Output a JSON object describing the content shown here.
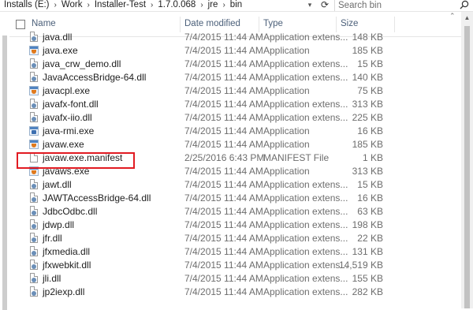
{
  "breadcrumb": [
    "Installs (E:)",
    "Work",
    "Installer-Test",
    "1.7.0.068",
    "jre",
    "bin"
  ],
  "breadcrumb_separator": "›",
  "search": {
    "placeholder": "Search bin"
  },
  "columns": {
    "name": "Name",
    "date": "Date modified",
    "type": "Type",
    "size": "Size"
  },
  "files": [
    {
      "name": "java.dll",
      "date": "7/4/2015 11:44 AM",
      "type": "Application extens...",
      "size": "148 KB",
      "icon": "dll-icon"
    },
    {
      "name": "java.exe",
      "date": "7/4/2015 11:44 AM",
      "type": "Application",
      "size": "185 KB",
      "icon": "java-exe-icon"
    },
    {
      "name": "java_crw_demo.dll",
      "date": "7/4/2015 11:44 AM",
      "type": "Application extens...",
      "size": "15 KB",
      "icon": "dll-icon"
    },
    {
      "name": "JavaAccessBridge-64.dll",
      "date": "7/4/2015 11:44 AM",
      "type": "Application extens...",
      "size": "140 KB",
      "icon": "dll-icon"
    },
    {
      "name": "javacpl.exe",
      "date": "7/4/2015 11:44 AM",
      "type": "Application",
      "size": "75 KB",
      "icon": "java-exe-icon"
    },
    {
      "name": "javafx-font.dll",
      "date": "7/4/2015 11:44 AM",
      "type": "Application extens...",
      "size": "313 KB",
      "icon": "dll-icon"
    },
    {
      "name": "javafx-iio.dll",
      "date": "7/4/2015 11:44 AM",
      "type": "Application extens...",
      "size": "225 KB",
      "icon": "dll-icon"
    },
    {
      "name": "java-rmi.exe",
      "date": "7/4/2015 11:44 AM",
      "type": "Application",
      "size": "16 KB",
      "icon": "app-exe-icon"
    },
    {
      "name": "javaw.exe",
      "date": "7/4/2015 11:44 AM",
      "type": "Application",
      "size": "185 KB",
      "icon": "java-exe-icon"
    },
    {
      "name": "javaw.exe.manifest",
      "date": "2/25/2016 6:43 PM",
      "type": "MANIFEST File",
      "size": "1 KB",
      "icon": "file-icon"
    },
    {
      "name": "javaws.exe",
      "date": "7/4/2015 11:44 AM",
      "type": "Application",
      "size": "313 KB",
      "icon": "java-exe-icon"
    },
    {
      "name": "jawt.dll",
      "date": "7/4/2015 11:44 AM",
      "type": "Application extens...",
      "size": "15 KB",
      "icon": "dll-icon"
    },
    {
      "name": "JAWTAccessBridge-64.dll",
      "date": "7/4/2015 11:44 AM",
      "type": "Application extens...",
      "size": "16 KB",
      "icon": "dll-icon"
    },
    {
      "name": "JdbcOdbc.dll",
      "date": "7/4/2015 11:44 AM",
      "type": "Application extens...",
      "size": "63 KB",
      "icon": "dll-icon"
    },
    {
      "name": "jdwp.dll",
      "date": "7/4/2015 11:44 AM",
      "type": "Application extens...",
      "size": "198 KB",
      "icon": "dll-icon"
    },
    {
      "name": "jfr.dll",
      "date": "7/4/2015 11:44 AM",
      "type": "Application extens...",
      "size": "22 KB",
      "icon": "dll-icon"
    },
    {
      "name": "jfxmedia.dll",
      "date": "7/4/2015 11:44 AM",
      "type": "Application extens...",
      "size": "131 KB",
      "icon": "dll-icon"
    },
    {
      "name": "jfxwebkit.dll",
      "date": "7/4/2015 11:44 AM",
      "type": "Application extens...",
      "size": "14,519 KB",
      "icon": "dll-icon"
    },
    {
      "name": "jli.dll",
      "date": "7/4/2015 11:44 AM",
      "type": "Application extens...",
      "size": "155 KB",
      "icon": "dll-icon"
    },
    {
      "name": "jp2iexp.dll",
      "date": "7/4/2015 11:44 AM",
      "type": "Application extens...",
      "size": "282 KB",
      "icon": "dll-icon"
    }
  ],
  "highlighted_file": "javaw.exe.manifest",
  "colors": {
    "highlight_border": "#e11b22",
    "header_text": "#4c607a",
    "secondary_text": "#6d6d6d"
  }
}
